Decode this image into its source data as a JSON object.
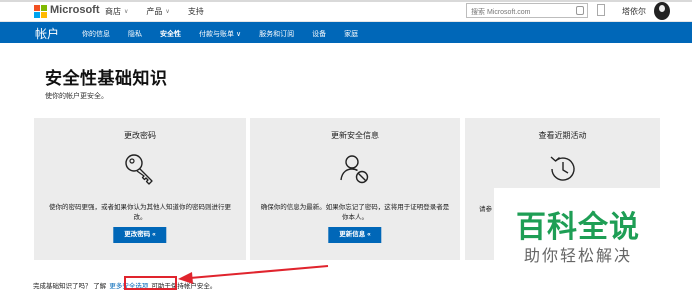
{
  "header": {
    "brand": "Microsoft",
    "nav": [
      {
        "label": "商店",
        "has_caret": true
      },
      {
        "label": "产品",
        "has_caret": true
      },
      {
        "label": "支持",
        "has_caret": false
      }
    ],
    "search_placeholder": "搜索 Microsoft.com",
    "user_name": "塔依尔",
    "logo_colors": [
      "#f25022",
      "#7fba00",
      "#00a4ef",
      "#ffb900"
    ]
  },
  "account_nav": {
    "title": "帐户",
    "tabs": [
      {
        "label": "你的信息"
      },
      {
        "label": "隐私"
      },
      {
        "label": "安全性",
        "active": true
      },
      {
        "label": "付款与账单 ∨"
      },
      {
        "label": "服务和订阅"
      },
      {
        "label": "设备"
      },
      {
        "label": "家庭"
      }
    ]
  },
  "page": {
    "title": "安全性基础知识",
    "subtitle": "使你的帐户更安全。"
  },
  "cards": [
    {
      "title": "更改密码",
      "icon": "key-icon",
      "description": "使你的密码更强，或者如果你认为其他人知道你的密码则进行更改。",
      "button": "更改密码 «"
    },
    {
      "title": "更新安全信息",
      "icon": "user-block-icon",
      "description": "确保你的信息为最新。如果你忘记了密码，这将用于证明登录者是你本人。",
      "button": "更新信息 «"
    },
    {
      "title": "查看近期活动",
      "icon": "history-icon",
      "description_visible_fragment": "请参",
      "button": ""
    }
  ],
  "footer_note": {
    "before": "完成基础知识了吗？ 了解",
    "link": "更多安全选项",
    "after": "可助于保持帐户安全。"
  },
  "watermark": {
    "big": "百科全说",
    "small": "助你轻松解决"
  },
  "colors": {
    "accent": "#0067b8",
    "card_bg": "#ececec",
    "annotation_red": "#e0242d",
    "watermark_green": "#1e9e55"
  }
}
